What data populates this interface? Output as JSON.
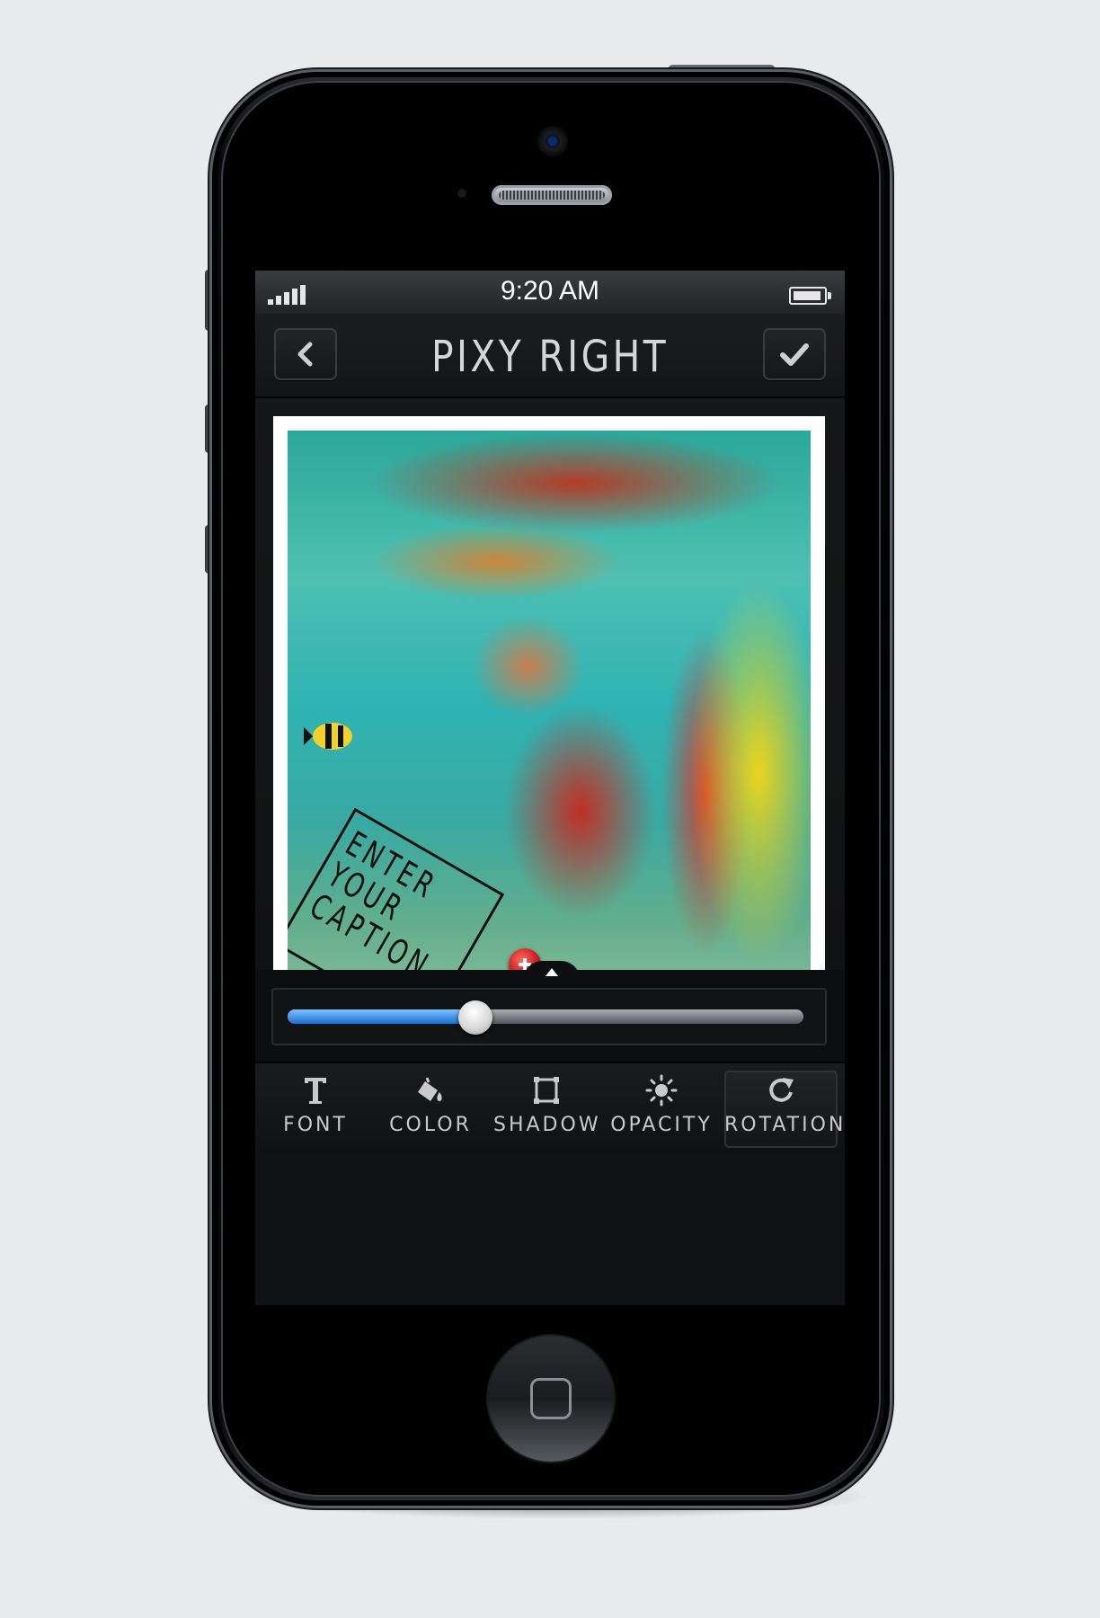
{
  "status_bar": {
    "time": "9:20 AM",
    "signal_icon": "signal-bars-icon",
    "battery_icon": "battery-icon"
  },
  "nav_bar": {
    "title": "PIXY RIGHT",
    "back_icon": "chevron-left-icon",
    "confirm_icon": "checkmark-icon"
  },
  "photo": {
    "caption_text": "ENTER\nYOUR\nCAPTION",
    "add_icon": "plus-icon"
  },
  "slider": {
    "value_fraction": 0.35,
    "fill_color": "#1a6fd6"
  },
  "toolbar": {
    "items": [
      {
        "label": "FONT",
        "icon": "text-icon"
      },
      {
        "label": "COLOR",
        "icon": "paint-bucket-icon"
      },
      {
        "label": "SHADOW",
        "icon": "square-icon"
      },
      {
        "label": "OPACITY",
        "icon": "sun-icon"
      },
      {
        "label": "ROTATION",
        "icon": "rotate-icon",
        "active": true
      }
    ]
  }
}
